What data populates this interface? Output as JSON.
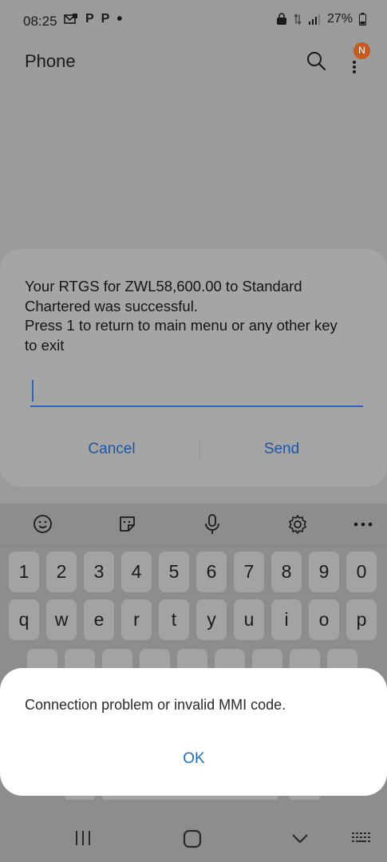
{
  "status_bar": {
    "time": "08:25",
    "left_icons": [
      "email-notification-icon",
      "P",
      "P",
      "dot"
    ],
    "battery": "27%"
  },
  "app_bar": {
    "title": "Phone",
    "badge": "N"
  },
  "ussd_dialog": {
    "message": "Your RTGS for ZWL58,600.00 to Standard\nChartered was successful.\nPress 1 to return to main menu or any other key\nto exit",
    "input_value": "",
    "cancel_label": "Cancel",
    "send_label": "Send"
  },
  "keyboard": {
    "toolbar_icons": [
      "emoji-icon",
      "sticker-icon",
      "microphone-icon",
      "settings-icon",
      "more-icon"
    ],
    "number_row": [
      "1",
      "2",
      "3",
      "4",
      "5",
      "6",
      "7",
      "8",
      "9",
      "0"
    ],
    "letter_row_1": [
      "q",
      "w",
      "e",
      "r",
      "t",
      "y",
      "u",
      "i",
      "o",
      "p"
    ]
  },
  "toast_dialog": {
    "message": "Connection problem or invalid MMI code.",
    "ok_label": "OK"
  },
  "nav_bar": {
    "icons": [
      "recent-apps-icon",
      "home-icon",
      "back-icon",
      "keyboard-toggle-icon"
    ]
  }
}
